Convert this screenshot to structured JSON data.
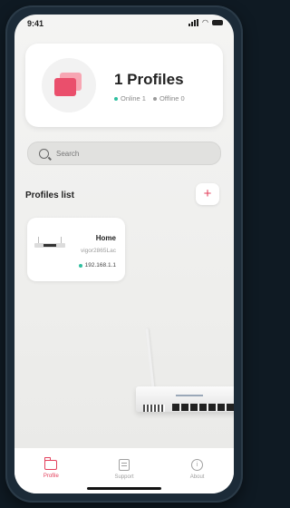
{
  "status_bar": {
    "time": "9:41"
  },
  "summary": {
    "title": "1 Profiles",
    "online_label": "Online 1",
    "offline_label": "Offline 0",
    "online_color": "#2fbf9f",
    "offline_color": "#9a9a9a",
    "icon": "profiles-stack-icon"
  },
  "search": {
    "placeholder": "Search"
  },
  "profiles_list": {
    "heading": "Profiles list",
    "add_label": "+",
    "items": [
      {
        "name": "Home",
        "model": "vigor2865Lac",
        "ip": "192.168.1.1",
        "status": "online"
      }
    ]
  },
  "tab_bar": {
    "tabs": [
      {
        "label": "Profile",
        "icon": "folder-icon",
        "active": true
      },
      {
        "label": "Support",
        "icon": "support-icon",
        "active": false
      },
      {
        "label": "About",
        "icon": "info-icon",
        "active": false
      }
    ]
  },
  "colors": {
    "accent": "#e3405c",
    "background": "#f2f2f1",
    "card": "#ffffff"
  }
}
